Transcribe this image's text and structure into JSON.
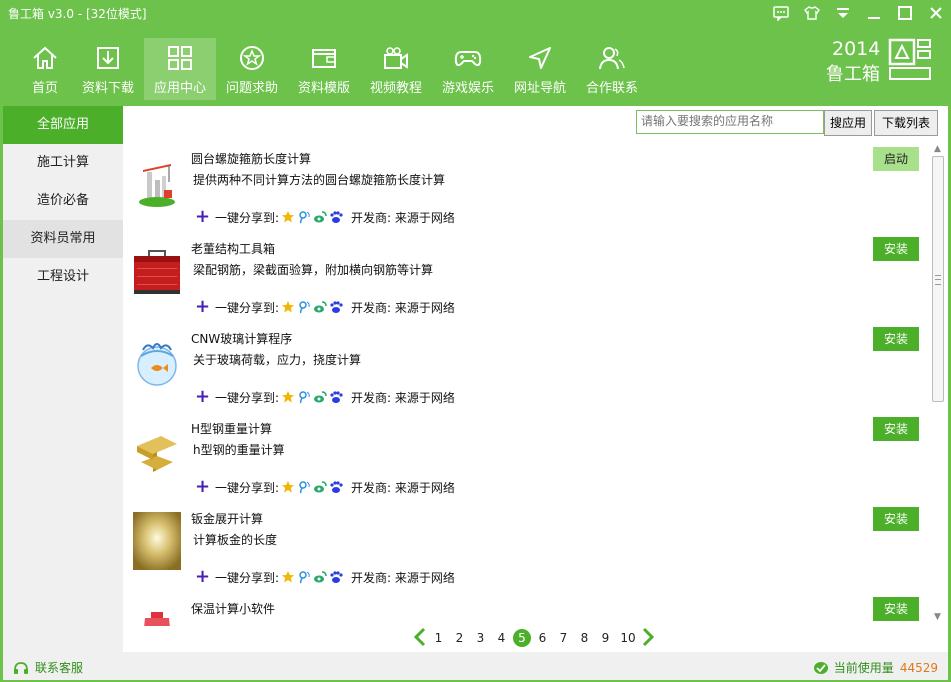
{
  "window": {
    "title": "鲁工箱 v3.0 - [32位模式]"
  },
  "window_buttons": [
    "chat-icon",
    "shirt-icon",
    "dropdown-icon",
    "minimize-icon",
    "maximize-icon",
    "close-icon"
  ],
  "nav": [
    {
      "label": "首页",
      "icon": "home-icon"
    },
    {
      "label": "资料下载",
      "icon": "download-icon"
    },
    {
      "label": "应用中心",
      "icon": "apps-icon",
      "active": true
    },
    {
      "label": "问题求助",
      "icon": "help-star-icon"
    },
    {
      "label": "资料模版",
      "icon": "wallet-icon"
    },
    {
      "label": "视频教程",
      "icon": "camera-icon"
    },
    {
      "label": "游戏娱乐",
      "icon": "gamepad-icon"
    },
    {
      "label": "网址导航",
      "icon": "navigation-arrow-icon"
    },
    {
      "label": "合作联系",
      "icon": "contacts-icon"
    }
  ],
  "brand": {
    "year": "2014",
    "name": "鲁工箱"
  },
  "sidebar": [
    {
      "label": "全部应用",
      "active": true
    },
    {
      "label": "施工计算"
    },
    {
      "label": "造价必备"
    },
    {
      "label": "资料员常用",
      "alt": true
    },
    {
      "label": "工程设计"
    }
  ],
  "search": {
    "placeholder": "请输入要搜索的应用名称",
    "button": "搜应用"
  },
  "download_list_button": "下载列表",
  "share_text": "一键分享到:",
  "share_icons": [
    "qzone-star-icon",
    "tencent-weibo-icon",
    "sina-weibo-icon",
    "baidu-paw-icon"
  ],
  "apps": [
    {
      "name": "圆台螺旋箍筋长度计算",
      "desc": "提供两种不同计算方法的圆台螺旋箍筋长度计算",
      "developer": "开发商: 来源于网络",
      "action": "启动",
      "installed": true,
      "icon": "construction-icon"
    },
    {
      "name": "老董结构工具箱",
      "desc": "梁配钢筋，梁截面验算，附加横向钢筋等计算",
      "developer": "开发商: 来源于网络",
      "action": "安装",
      "installed": false,
      "icon": "red-toolbox-icon"
    },
    {
      "name": "CNW玻璃计算程序",
      "desc": "关于玻璃荷载，应力，挠度计算",
      "developer": "开发商: 来源于网络",
      "action": "安装",
      "installed": false,
      "icon": "fishbowl-icon"
    },
    {
      "name": "H型钢重量计算",
      "desc": "h型钢的重量计算",
      "developer": "开发商: 来源于网络",
      "action": "安装",
      "installed": false,
      "icon": "h-beam-icon"
    },
    {
      "name": "钣金展开计算",
      "desc": "计算板金的长度",
      "developer": "开发商: 来源于网络",
      "action": "安装",
      "installed": false,
      "icon": "metal-sheet-icon"
    },
    {
      "name": "保温计算小软件",
      "desc": "",
      "developer": "",
      "action": "安装",
      "installed": false,
      "icon": "red-cylinder-icon"
    }
  ],
  "pagination": {
    "pages": [
      "1",
      "2",
      "3",
      "4",
      "5",
      "6",
      "7",
      "8",
      "9",
      "10"
    ],
    "current": "5"
  },
  "footer": {
    "contact": "联系客服",
    "usage_label": "当前使用量",
    "usage_count": "44529"
  },
  "colors": {
    "brand_green": "#6cc24a",
    "accent_green": "#4caf29",
    "count_orange": "#e0781a"
  }
}
